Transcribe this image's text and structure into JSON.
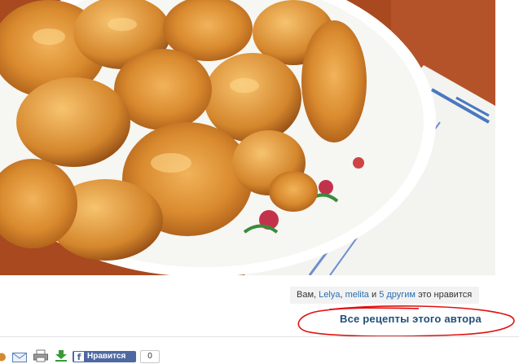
{
  "photo": {
    "icon": "fried-chicken-photo"
  },
  "likes": {
    "prefix": "Вам,",
    "user1": "Lelya",
    "sep": ",",
    "user2": "melita",
    "and": "и",
    "others": "5 другим",
    "suffix": "это нравится"
  },
  "author_link": "Все рецепты этого автора",
  "toolbar": {
    "icons": [
      "share-icon",
      "email-icon",
      "print-icon",
      "download-icon"
    ],
    "fb_like_label": "Нравится",
    "fb_count": "0"
  },
  "colors": {
    "link": "#1f4f79",
    "annotation": "#e01010",
    "facebook": "#4e69a2"
  }
}
